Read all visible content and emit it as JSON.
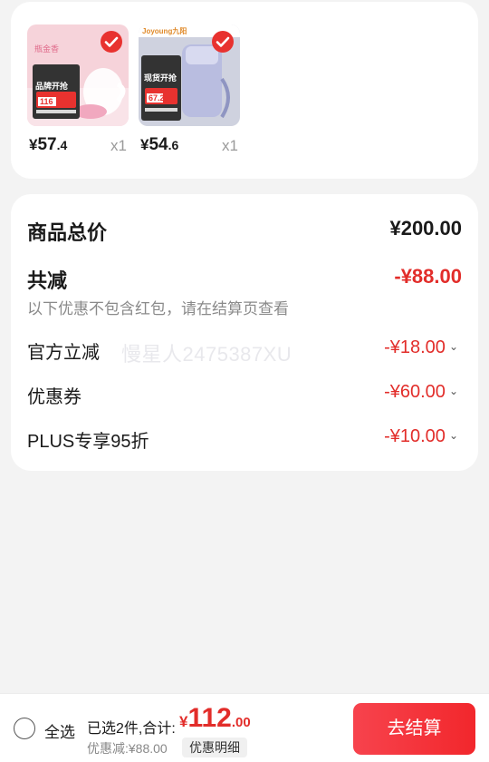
{
  "products": [
    {
      "badge": "瓶金香",
      "promo_line": "品牌开抢",
      "promo_price": "116",
      "price_currency": "¥",
      "price_int": "57",
      "price_dec": ".4",
      "qty": "x1"
    },
    {
      "badge": "Joyoung九阳",
      "promo_line": "现货开抢",
      "promo_price": "67.2",
      "price_currency": "¥",
      "price_int": "54",
      "price_dec": ".6",
      "qty": "x1"
    }
  ],
  "summary": {
    "total_label": "商品总价",
    "total_value": "¥200.00",
    "reduce_label": "共减",
    "reduce_value": "-¥88.00",
    "note": "以下优惠不包含红包，请在结算页查看",
    "items": [
      {
        "label": "官方立减",
        "value": "-¥18.00"
      },
      {
        "label": "优惠券",
        "value": "-¥60.00"
      },
      {
        "label": "PLUS专享95折",
        "value": "-¥10.00"
      }
    ]
  },
  "watermark": "慢星人2475387XU",
  "bottom": {
    "select_all": "全选",
    "summary_text": "已选2件,合计:",
    "total_currency": "¥",
    "total_int": "112",
    "total_dec": ".00",
    "saved": "优惠减:¥88.00",
    "detail_button": "优惠明细",
    "checkout_button": "去结算"
  },
  "colors": {
    "accent_red": "#e22d2a",
    "checkout_red": "#f2272c",
    "background": "#f3f3f3"
  },
  "icons": {
    "product_check": "checkmark-circle-icon",
    "row_expand": "chevron-down-icon",
    "select_all": "radio-empty-icon"
  }
}
